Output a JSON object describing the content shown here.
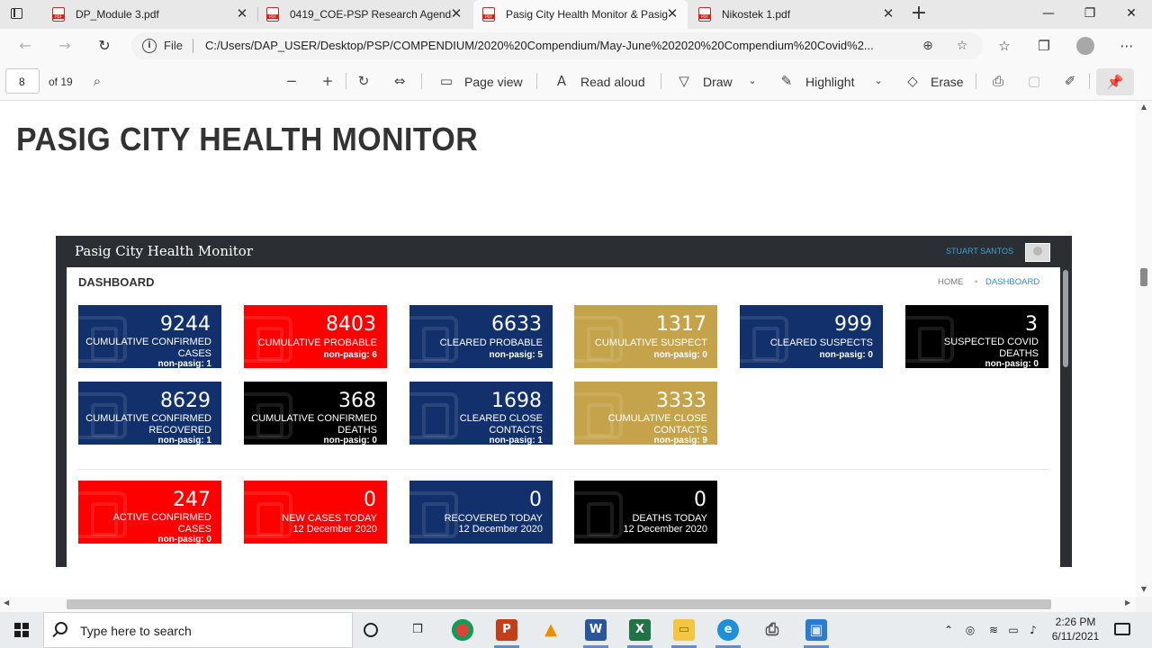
{
  "browser": {
    "tabs": [
      {
        "title": "DP_Module 3.pdf",
        "active": false
      },
      {
        "title": "0419_COE-PSP Research Agenda",
        "active": false
      },
      {
        "title": "Pasig City Health Monitor & Pasig",
        "active": true
      },
      {
        "title": "Nikostek 1.pdf",
        "active": false
      }
    ],
    "close_glyph": "✕",
    "new_tab_glyph": "+",
    "window_controls": {
      "minimize": "—",
      "maximize": "❐",
      "close": "✕"
    },
    "address": {
      "scheme_label": "File",
      "url": "C:/Users/DAP_USER/Desktop/PSP/COMPENDIUM/2020%20Compendium/May-June%202020%20Compendium%20Covid%2..."
    }
  },
  "pdf_toolbar": {
    "page_number": "8",
    "page_total": "of 19",
    "page_view": "Page view",
    "read_aloud": "Read aloud",
    "draw": "Draw",
    "highlight": "Highlight",
    "erase": "Erase"
  },
  "document": {
    "heading": "PASIG CITY HEALTH MONITOR"
  },
  "dashboard": {
    "brand": "Pasig City Health Monitor",
    "user": "STUART SANTOS",
    "heading": "DASHBOARD",
    "breadcrumb": {
      "home": "HOME",
      "separator": "•",
      "current": "DASHBOARD"
    },
    "colors": {
      "navy": "#12306b",
      "red": "#ff0000",
      "gold": "#c4a34b",
      "black": "#000000"
    },
    "cards": [
      {
        "value": "9244",
        "label_1": "CUMULATIVE CONFIRMED",
        "label_2": "CASES",
        "sub": "non-pasig: 1",
        "color": "#12306b"
      },
      {
        "value": "8403",
        "label_1": "CUMULATIVE PROBABLE",
        "label_2": "",
        "sub": "non-pasig: 6",
        "color": "#ff0000"
      },
      {
        "value": "6633",
        "label_1": "CLEARED PROBABLE",
        "label_2": "",
        "sub": "non-pasig: 5",
        "color": "#12306b"
      },
      {
        "value": "1317",
        "label_1": "CUMULATIVE SUSPECT",
        "label_2": "",
        "sub": "non-pasig: 0",
        "color": "#c4a34b"
      },
      {
        "value": "999",
        "label_1": "CLEARED SUSPECTS",
        "label_2": "",
        "sub": "non-pasig: 0",
        "color": "#12306b"
      },
      {
        "value": "3",
        "label_1": "SUSPECTED COVID",
        "label_2": "DEATHS",
        "sub": "non-pasig: 0",
        "color": "#000000"
      },
      {
        "value": "8629",
        "label_1": "CUMULATIVE CONFIRMED",
        "label_2": "RECOVERED",
        "sub": "non-pasig: 1",
        "color": "#12306b"
      },
      {
        "value": "368",
        "label_1": "CUMULATIVE CONFIRMED",
        "label_2": "DEATHS",
        "sub": "non-pasig: 0",
        "color": "#000000"
      },
      {
        "value": "1698",
        "label_1": "CLEARED CLOSE",
        "label_2": "CONTACTS",
        "sub": "non-pasig: 1",
        "color": "#12306b"
      },
      {
        "value": "3333",
        "label_1": "CUMULATIVE CLOSE",
        "label_2": "CONTACTS",
        "sub": "non-pasig: 9",
        "color": "#c4a34b"
      }
    ],
    "today_cards": [
      {
        "value": "247",
        "label_1": "ACTIVE CONFIRMED",
        "label_2": "CASES",
        "sub": "non-pasig: 0",
        "color": "#ff0000"
      },
      {
        "value": "0",
        "label_1": "NEW CASES TODAY",
        "label_2": "12 December 2020",
        "sub": "",
        "color": "#ff0000"
      },
      {
        "value": "0",
        "label_1": "RECOVERED TODAY",
        "label_2": "12 December 2020",
        "sub": "",
        "color": "#12306b"
      },
      {
        "value": "0",
        "label_1": "DEATHS TODAY",
        "label_2": "12 December 2020",
        "sub": "",
        "color": "#000000"
      }
    ]
  },
  "taskbar": {
    "search_placeholder": "Type here to search",
    "apps": [
      {
        "name": "task-view-icon",
        "glyph": "❒"
      },
      {
        "name": "chrome-icon",
        "glyph": "●"
      },
      {
        "name": "powerpoint-icon",
        "glyph": "P"
      },
      {
        "name": "vlc-icon",
        "glyph": "▲"
      },
      {
        "name": "word-icon",
        "glyph": "W"
      },
      {
        "name": "excel-icon",
        "glyph": "X"
      },
      {
        "name": "file-explorer-icon",
        "glyph": "▭"
      },
      {
        "name": "edge-icon",
        "glyph": "e"
      },
      {
        "name": "printer-icon",
        "glyph": "⎙"
      },
      {
        "name": "photos-icon",
        "glyph": "▣"
      }
    ],
    "time": "2:26 PM",
    "date": "6/11/2021"
  }
}
